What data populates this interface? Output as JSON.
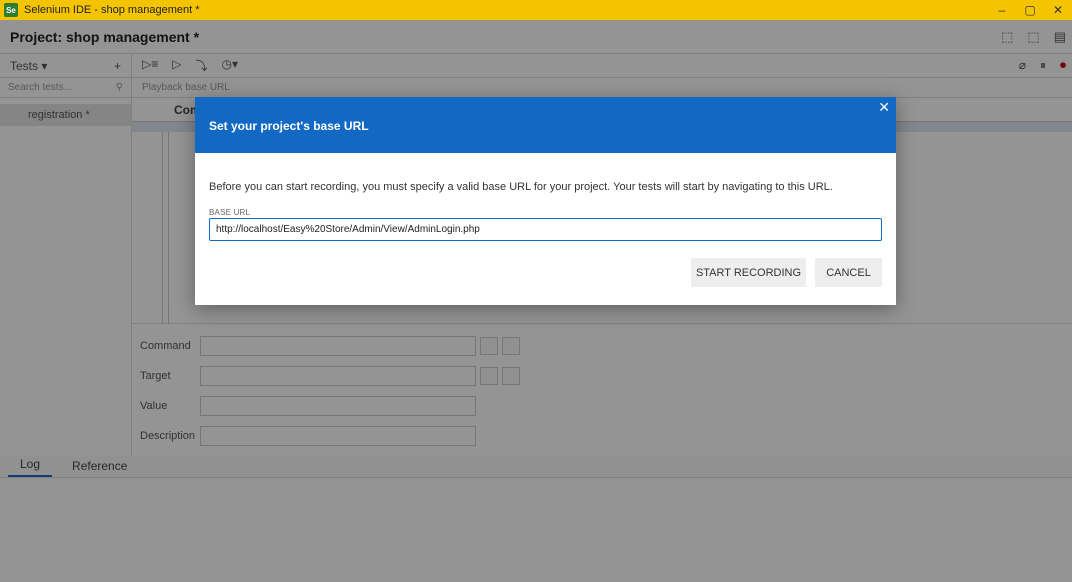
{
  "window": {
    "title": "Selenium IDE - shop management *",
    "logo": "Se",
    "controls": {
      "minimize": "–",
      "maximize": "▢",
      "close": "✕"
    }
  },
  "project": {
    "title": "Project: shop management *"
  },
  "sidebar": {
    "tests_label": "Tests",
    "tests_dropdown": "▾",
    "add": "+",
    "search_placeholder": "Search tests...",
    "items": [
      {
        "label": "registration *"
      }
    ]
  },
  "toolbar": {
    "playback_placeholder": "Playback base URL"
  },
  "grid": {
    "command_header": "Com"
  },
  "editor": {
    "command_label": "Command",
    "target_label": "Target",
    "value_label": "Value",
    "description_label": "Description"
  },
  "log": {
    "tabs": [
      "Log",
      "Reference"
    ]
  },
  "modal": {
    "title": "Set your project's base URL",
    "close": "✕",
    "description": "Before you can start recording, you must specify a valid base URL for your project. Your tests will start by navigating to this URL.",
    "base_url_label": "BASE URL",
    "base_url_value": "http://localhost/Easy%20Store/Admin/View/AdminLogin.php",
    "start_button": "START RECORDING",
    "cancel_button": "CANCEL"
  },
  "colors": {
    "titlebar": "#f5c400",
    "modal_header": "#1169c4"
  }
}
